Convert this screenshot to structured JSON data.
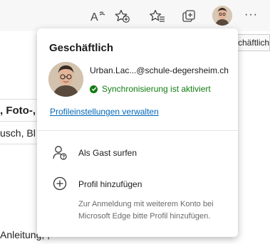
{
  "toolbar": {
    "icons": [
      "read-aloud-icon",
      "add-favorite-icon",
      "favorites-icon",
      "collections-icon",
      "profile-avatar",
      "more-icon"
    ],
    "more_label": "···"
  },
  "tooltip": {
    "text": "Geschäftlich"
  },
  "page_behind": {
    "fragments": [
      ", Foto-,",
      "usch, Bl",
      "Anleitung, ,"
    ]
  },
  "profile_flyout": {
    "title": "Geschäftlich",
    "email": "Urban.Lac...@schule-degersheim.ch",
    "sync_status": "Synchronisierung ist aktiviert",
    "manage_link": "Profileinstellungen verwalten",
    "guest_label": "Als Gast surfen",
    "add_profile_label": "Profil hinzufügen",
    "add_profile_description": "Zur Anmeldung mit weiterem Konto bei Microsoft Edge bitte Profil hinzufügen."
  },
  "colors": {
    "sync_green": "#107c10",
    "link_blue": "#0067b8"
  }
}
